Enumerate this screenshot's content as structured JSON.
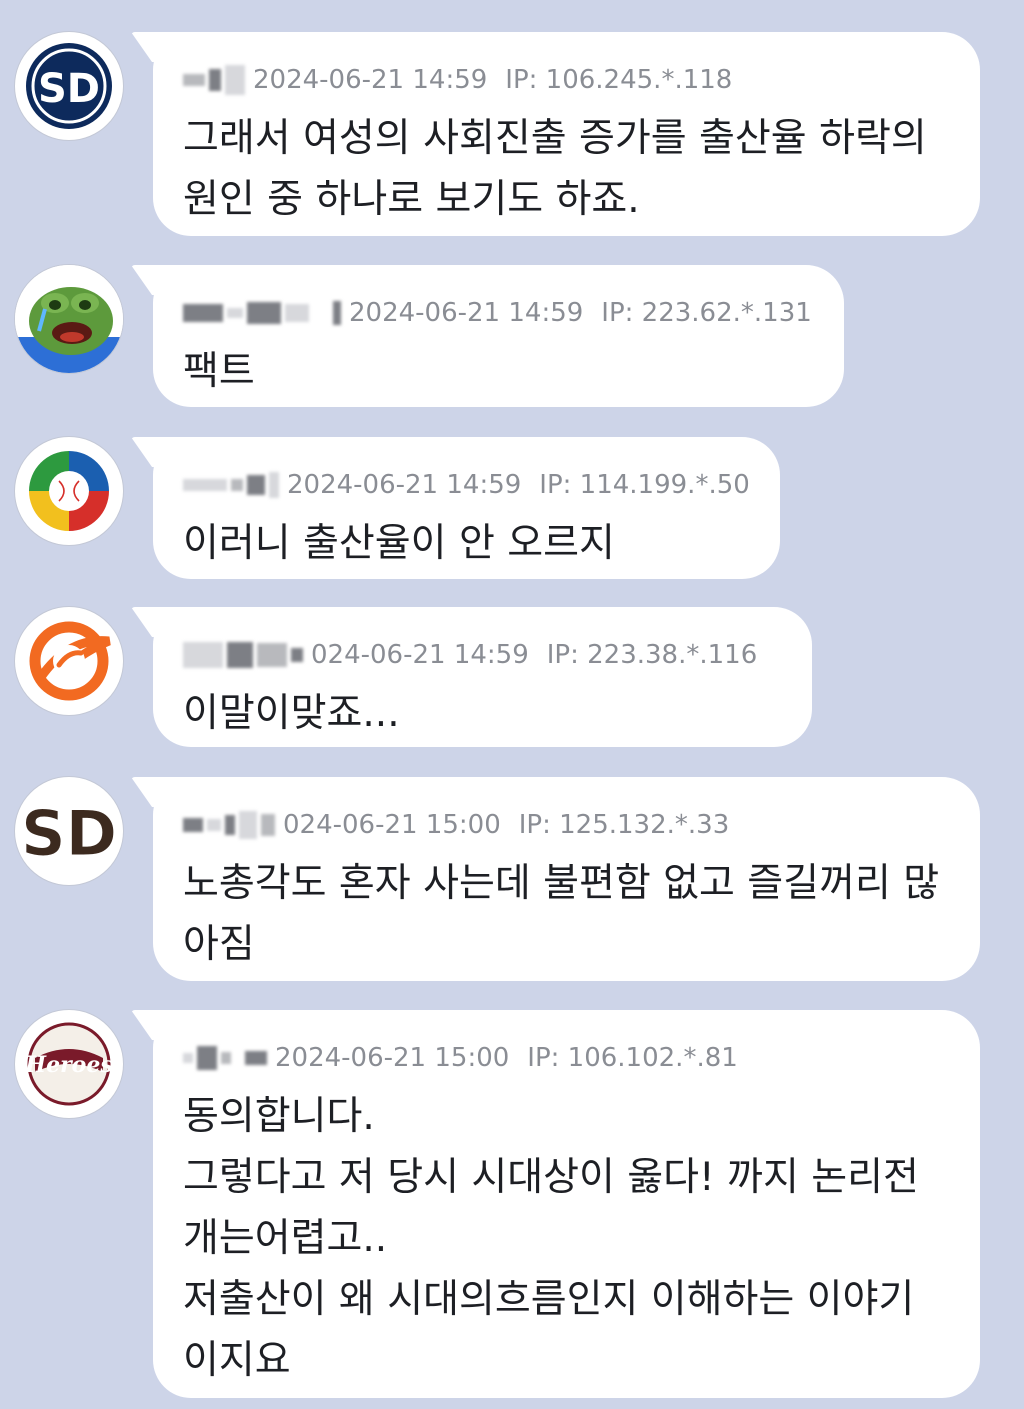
{
  "comments": [
    {
      "avatar": "padres-sd-logo-icon",
      "date": "2024-06-21 14:59",
      "ip": "IP: 106.245.*.118",
      "text": "그래서 여성의 사회진출 증가를 출산율 하락의\n원인 중 하나로 보기도 하죠."
    },
    {
      "avatar": "crying-frog-icon",
      "date": "2024-06-21 14:59",
      "ip": "IP: 223.62.*.131",
      "text": "팩트"
    },
    {
      "avatar": "world-baseball-classic-logo-icon",
      "date": "2024-06-21 14:59",
      "ip": "IP: 114.199.*.50",
      "text": "이러니 출산율이 안 오르지"
    },
    {
      "avatar": "eagles-logo-icon",
      "date": "024-06-21 14:59",
      "ip": "IP: 223.38.*.116",
      "text": "이말이맞죠..."
    },
    {
      "avatar": "padres-sd-brown-logo-icon",
      "date": "024-06-21 15:00",
      "ip": "IP: 125.132.*.33",
      "text": "노총각도 혼자 사는데 불편함 없고 즐길꺼리 많\n아짐"
    },
    {
      "avatar": "heroes-logo-icon",
      "avatar_text": "Heroes",
      "date": "2024-06-21 15:00",
      "ip": "IP: 106.102.*.81",
      "text": "동의합니다.\n그렇다고 저 당시 시대상이 옳다! 까지 논리전\n개는어렵고..\n저출산이 왜 시대의흐름인지 이해하는 이야기\n이지요"
    }
  ]
}
